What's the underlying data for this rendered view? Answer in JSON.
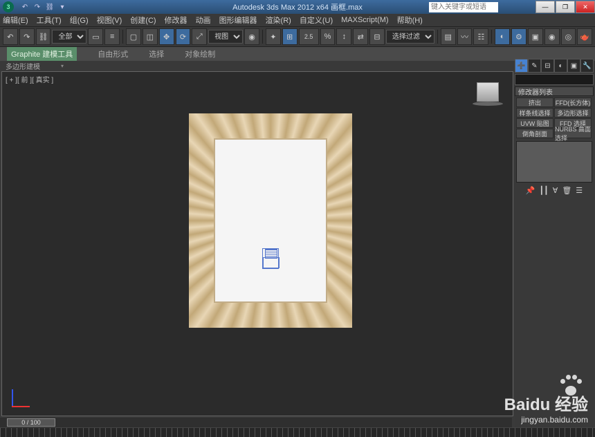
{
  "title": {
    "app": "Autodesk 3ds Max",
    "version": "2012 x64",
    "file": "画框.max",
    "search_placeholder": "键入关键字或短语"
  },
  "wincontrols": {
    "min": "—",
    "max": "❐",
    "close": "✕"
  },
  "menu": {
    "items": [
      "编辑(E)",
      "工具(T)",
      "组(G)",
      "视图(V)",
      "创建(C)",
      "修改器",
      "动画",
      "图形编辑器",
      "渲染(R)",
      "自定义(U)",
      "MAXScript(M)",
      "帮助(H)"
    ]
  },
  "toolbar": {
    "selection_set": "全部",
    "view_dd": "视图",
    "filter_dd": "选择过滤",
    "coord_input": "2.5"
  },
  "ribbon": {
    "tabs": [
      "Graphite 建模工具",
      "自由形式",
      "选择",
      "对象绘制"
    ],
    "panel_label": "多边形建模"
  },
  "viewport": {
    "label": "[ + ][ 前 ][ 真实 ]"
  },
  "sidepanel": {
    "rollout": "修改器列表",
    "buttons": [
      "挤出",
      "FFD(长方体)",
      "样条线选择",
      "多边形选择",
      "UVW 贴图",
      "FFD 选择",
      "倒角剖面",
      "NURBS 曲面选择"
    ]
  },
  "timeline": {
    "frame": "0 / 100"
  },
  "watermark": {
    "brand": "Baidu 经验",
    "url": "jingyan.baidu.com"
  }
}
